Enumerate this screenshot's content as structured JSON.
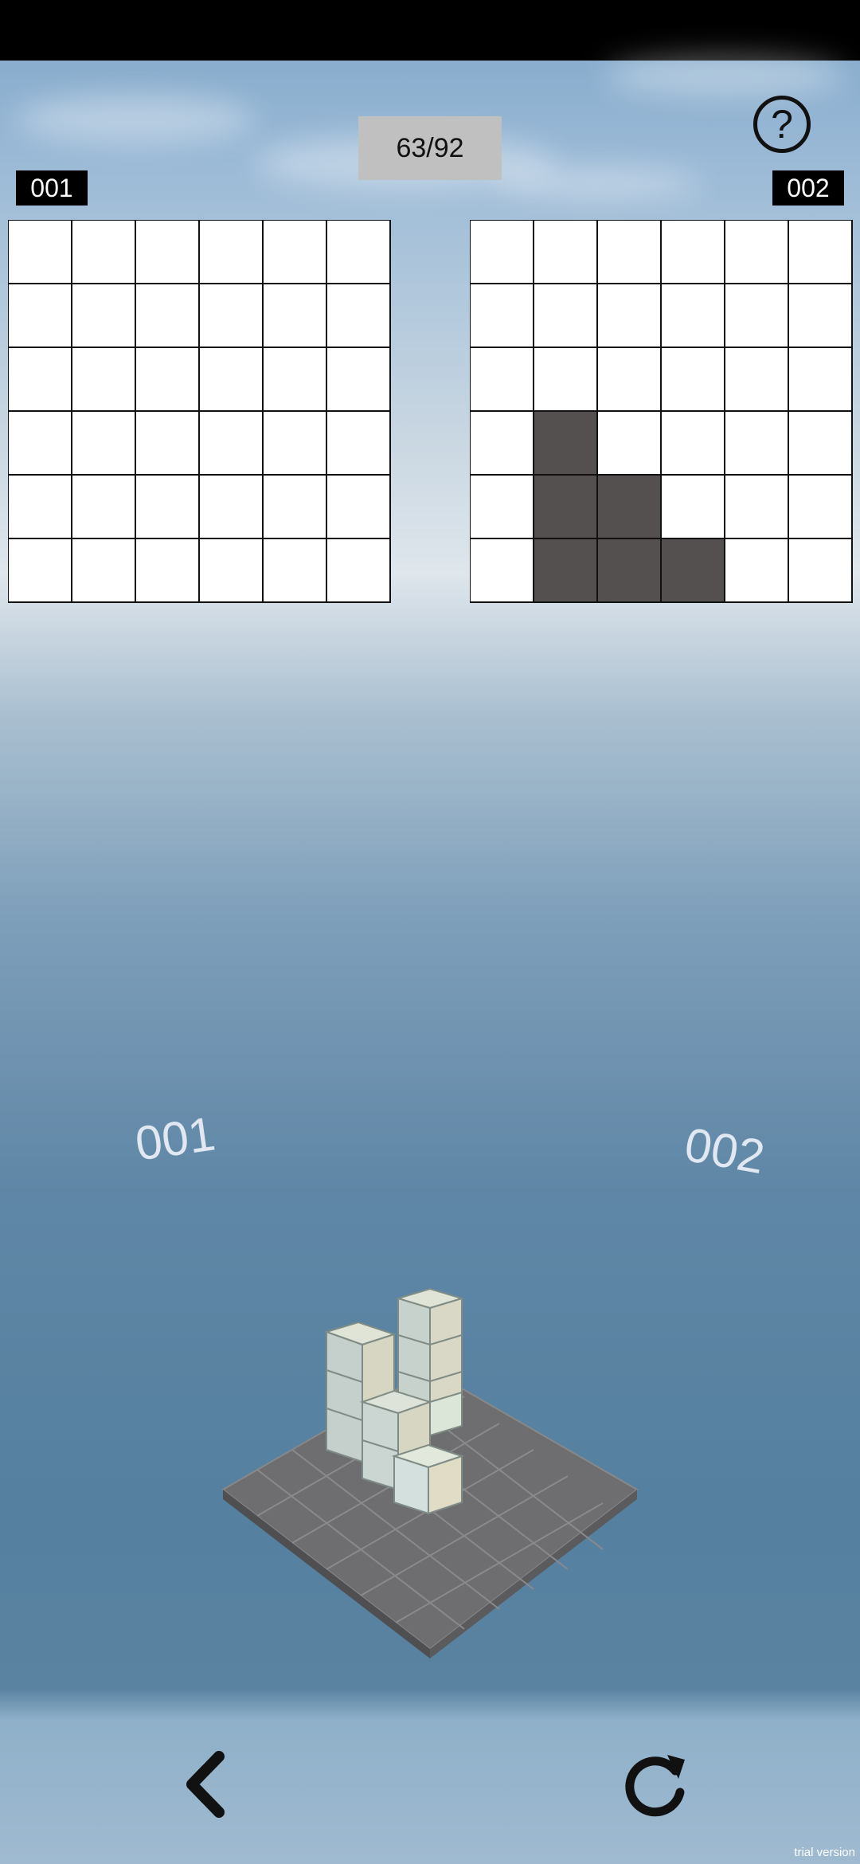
{
  "header": {
    "progress_text": "63/92",
    "help_label": "?"
  },
  "views": [
    {
      "label": "001",
      "rows": [
        [
          0,
          0,
          0,
          0,
          0,
          0
        ],
        [
          0,
          0,
          0,
          0,
          0,
          0
        ],
        [
          0,
          0,
          0,
          0,
          0,
          0
        ],
        [
          0,
          0,
          0,
          0,
          0,
          0
        ],
        [
          0,
          0,
          0,
          0,
          0,
          0
        ],
        [
          0,
          0,
          0,
          0,
          0,
          0
        ]
      ]
    },
    {
      "label": "002",
      "rows": [
        [
          0,
          0,
          0,
          0,
          0,
          0
        ],
        [
          0,
          0,
          0,
          0,
          0,
          0
        ],
        [
          0,
          0,
          0,
          0,
          0,
          0
        ],
        [
          0,
          1,
          0,
          0,
          0,
          0
        ],
        [
          0,
          1,
          1,
          0,
          0,
          0
        ],
        [
          0,
          1,
          1,
          1,
          0,
          0
        ]
      ]
    }
  ],
  "scene": {
    "label_left": "001",
    "label_right": "002"
  },
  "footer": {
    "back_icon": "chevron-left-icon",
    "reset_icon": "rotate-cw-icon",
    "watermark": "trial version"
  },
  "colors": {
    "filled_cell": "#545050",
    "empty_cell": "#ffffff",
    "board": "#6f6f72"
  }
}
